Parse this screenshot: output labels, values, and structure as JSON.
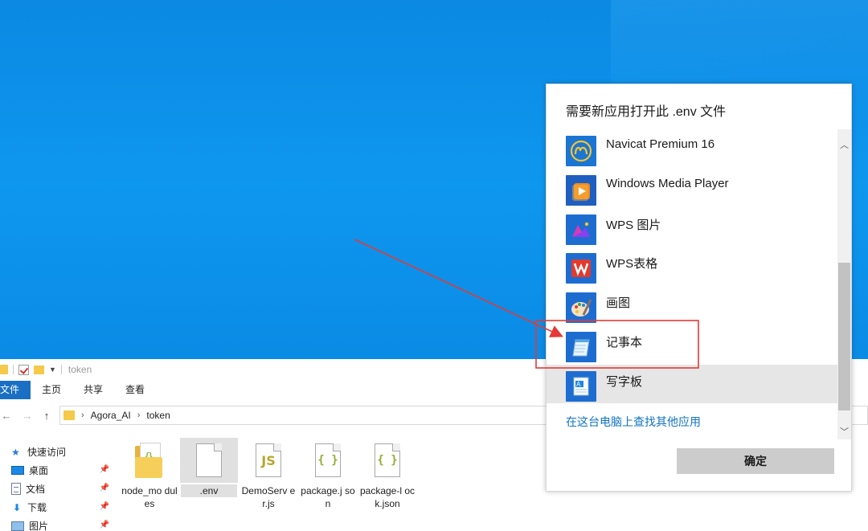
{
  "explorer": {
    "title": "token",
    "ribbon_tabs": [
      "文件",
      "主页",
      "共享",
      "查看"
    ],
    "breadcrumb": [
      "Agora_AI",
      "token"
    ],
    "quick_access": [
      {
        "label": "快速访问",
        "icon": "star-icon"
      },
      {
        "label": "桌面",
        "icon": "desktop-icon"
      },
      {
        "label": "文档",
        "icon": "documents-icon"
      },
      {
        "label": "下载",
        "icon": "download-icon"
      },
      {
        "label": "图片",
        "icon": "pictures-icon"
      }
    ],
    "files": [
      {
        "name": "node_modules",
        "display": "node_mo dules",
        "type": "folder"
      },
      {
        "name": ".env",
        "display": ".env",
        "type": "file",
        "selected": true
      },
      {
        "name": "DemoServer.js",
        "display": "DemoServ er.js",
        "type": "js"
      },
      {
        "name": "package.json",
        "display": "package.j son",
        "type": "json"
      },
      {
        "name": "package-lock.json",
        "display": "package-l ock.json",
        "type": "json"
      }
    ]
  },
  "dialog": {
    "title": "需要新应用打开此 .env 文件",
    "apps": [
      {
        "label": "Navicat Premium 16",
        "icon": "navicat-icon"
      },
      {
        "label": "Windows Media Player",
        "icon": "media-player-icon"
      },
      {
        "label": "WPS 图片",
        "icon": "wps-picture-icon"
      },
      {
        "label": "WPS表格",
        "icon": "wps-spreadsheet-icon"
      },
      {
        "label": "画图",
        "icon": "paint-icon"
      },
      {
        "label": "记事本",
        "icon": "notepad-icon"
      },
      {
        "label": "写字板",
        "icon": "wordpad-icon"
      }
    ],
    "more_apps_link": "在这台电脑上查找其他应用",
    "ok_label": "确定"
  },
  "colors": {
    "desktop": "#0a8ae4",
    "highlight_box": "#e53935",
    "link": "#1173c4",
    "file_tab": "#1a6fc4"
  }
}
